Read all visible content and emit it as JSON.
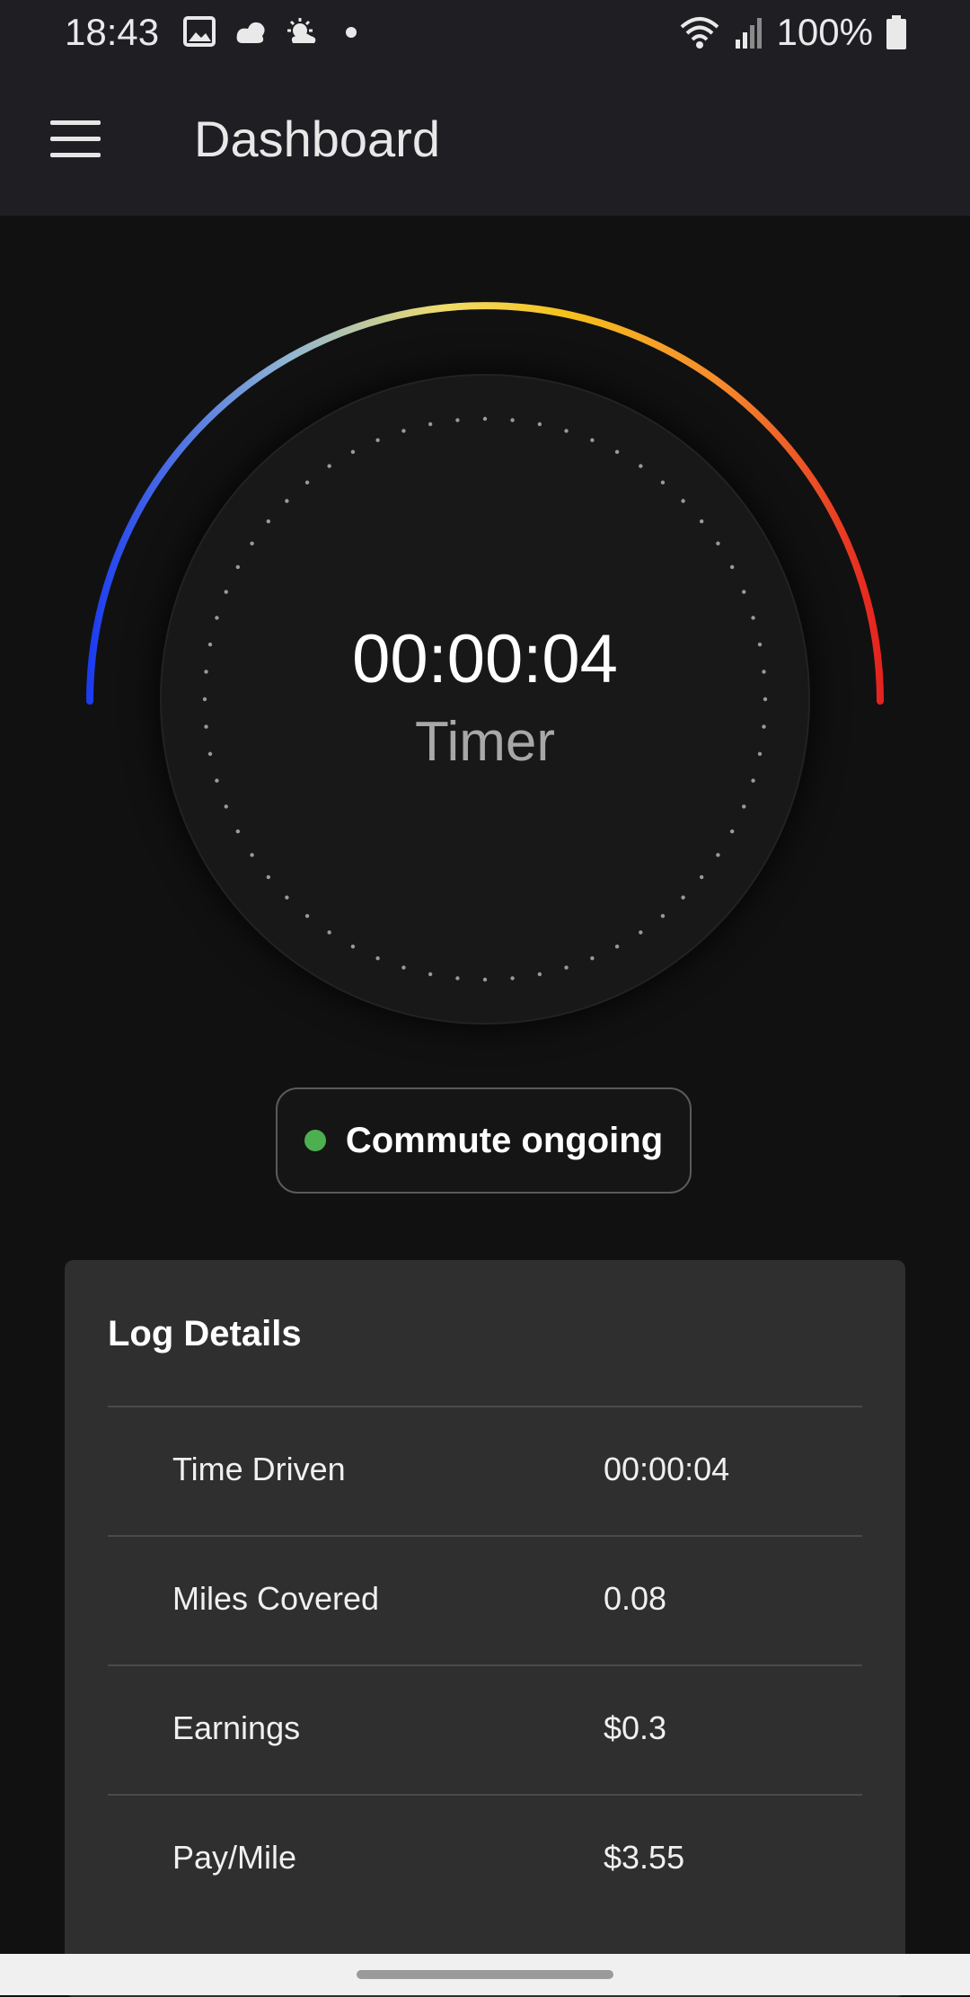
{
  "status_bar": {
    "time": "18:43",
    "battery": "100%",
    "icons": [
      "image-icon",
      "cloud-icon",
      "weather-icon",
      "dot-icon",
      "wifi-icon",
      "signal-icon",
      "battery-icon"
    ]
  },
  "app_bar": {
    "title": "Dashboard",
    "menu_icon": "hamburger-menu-icon"
  },
  "timer": {
    "value": "00:00:04",
    "label": "Timer",
    "gauge_colors": [
      "#1c3cf0",
      "#f6c21b",
      "#e5231f"
    ]
  },
  "commute_status": {
    "text": "Commute ongoing",
    "dot_color": "#4caf50"
  },
  "log_details": {
    "title": "Log Details",
    "rows": [
      {
        "label": "Time Driven",
        "value": "00:00:04"
      },
      {
        "label": "Miles Covered",
        "value": "0.08"
      },
      {
        "label": "Earnings",
        "value": "$0.3"
      },
      {
        "label": "Pay/Mile",
        "value": "$3.55"
      }
    ]
  }
}
